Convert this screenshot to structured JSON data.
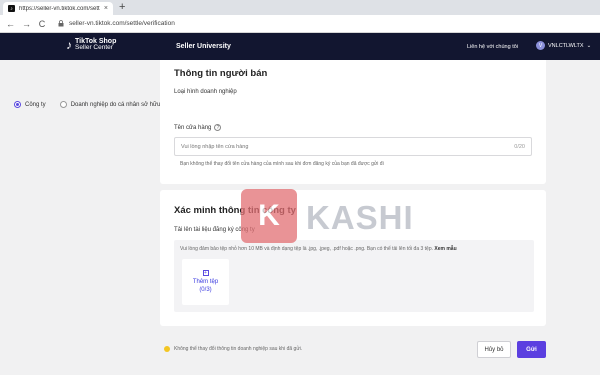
{
  "browser": {
    "tab_title": "https://seller-vn.tiktok.com/settl",
    "tab_close": "×",
    "new_tab": "+",
    "back": "←",
    "forward": "→",
    "reload": "C",
    "url": "seller-vn.tiktok.com/settle/verification"
  },
  "header": {
    "logo_line1": "TikTok Shop",
    "logo_line2": "Seller Center",
    "nav_item": "Seller University",
    "contact_link": "Liên hệ với chúng tôi",
    "user_name": "VNLCTLWLTX",
    "user_initial": "V"
  },
  "seller_info": {
    "title": "Thông tin người bán",
    "business_type_label": "Loại hình doanh nghiệp",
    "options": [
      "Công ty",
      "Doanh nghiệp do cá nhân sở hữu"
    ],
    "selected_option": "Công ty",
    "shop_name_label": "Tên cửa hàng",
    "shop_name_placeholder": "Vui lòng nhập tên cửa hàng",
    "shop_name_counter": "0/20",
    "shop_name_hint": "Bạn không thể thay đổi tên cửa hàng của mình sau khi đơn đăng ký của bạn đã được gửi đi"
  },
  "company_verification": {
    "title": "Xác minh thông tin công ty",
    "upload_label": "Tải lên tài liệu đăng ký công ty",
    "upload_desc": "Vui lòng đảm bảo tệp nhỏ hơn 10 MB và định dạng tệp là .jpg, .jpeg, .pdf hoặc .png. Bạn có thể tải lên tối đa 3 tệp.",
    "upload_example_link": "Xem mẫu",
    "add_file_label": "Thêm tệp",
    "add_file_count": "(0/3)"
  },
  "watermark": {
    "logo_letter": "K",
    "text": "KASHI"
  },
  "footer": {
    "warning": "Không thể thay đổi thông tin doanh nghiệp sau khi đã gửi.",
    "cancel_label": "Hủy bỏ",
    "submit_label": "Gửi"
  },
  "colors": {
    "header_bg": "#121630",
    "accent": "#5b3fe0",
    "page_bg": "#f1f1f2"
  }
}
